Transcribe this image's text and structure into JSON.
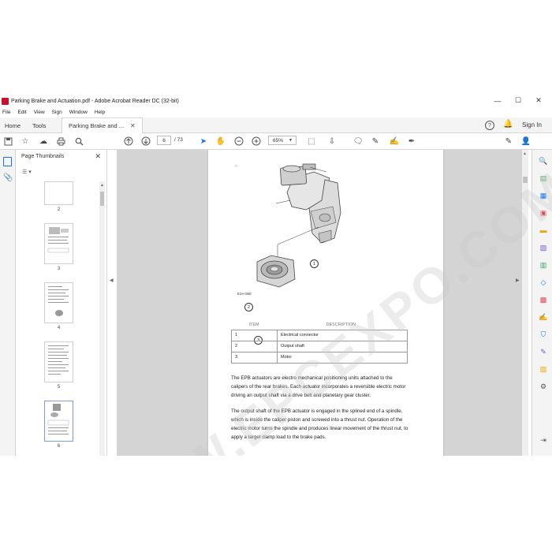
{
  "window": {
    "title": "Parking Brake and Actuation.pdf - Adobe Acrobat Reader DC (32-bit)",
    "minimize": "—",
    "maximize": "☐",
    "close": "✕"
  },
  "menu": [
    "File",
    "Edit",
    "View",
    "Sign",
    "Window",
    "Help"
  ],
  "tabs": {
    "home": "Home",
    "tools": "Tools",
    "document": "Parking Brake and ...",
    "close": "✕",
    "help_icon": "?",
    "sign_in": "Sign In"
  },
  "toolbar": {
    "current_page": "6",
    "page_count": "/ 73",
    "zoom": "65%"
  },
  "left_panel": {
    "title": "Page Thumbnails",
    "thumbnails": [
      {
        "label": "2"
      },
      {
        "label": "3"
      },
      {
        "label": "4"
      },
      {
        "label": "5"
      },
      {
        "label": "6"
      }
    ]
  },
  "document": {
    "figure_code": "E1H 060",
    "callouts": [
      "1",
      "2",
      "3"
    ],
    "table": {
      "headers": [
        "ITEM",
        "DESCRIPTION"
      ],
      "rows": [
        {
          "item": "1",
          "description": "Electrical connector"
        },
        {
          "item": "2",
          "description": "Output shaft"
        },
        {
          "item": "3",
          "description": "Motor"
        }
      ]
    },
    "paragraph1": "The EPB actuators are electro mechanical positioning units attached to the calipers of the rear brakes. Each actuator incorporates a reversible electric motor driving an output shaft via a drive belt and planetary gear cluster.",
    "paragraph2": "The output shaft of the EPB actuator is engaged in the splined end of a spindle, which is inside the caliper piston and screwed into a thrust nut. Operation of the electric motor turns the spindle and produces linear movement of the thrust nut, to apply a target clamp load to the brake pads."
  },
  "watermark": "WWW.EPCEXPO.COM",
  "colors": {
    "accent_red": "#c8102e",
    "viewer_bg": "#d4d4d4",
    "panel_bg": "#f4f4f4"
  }
}
